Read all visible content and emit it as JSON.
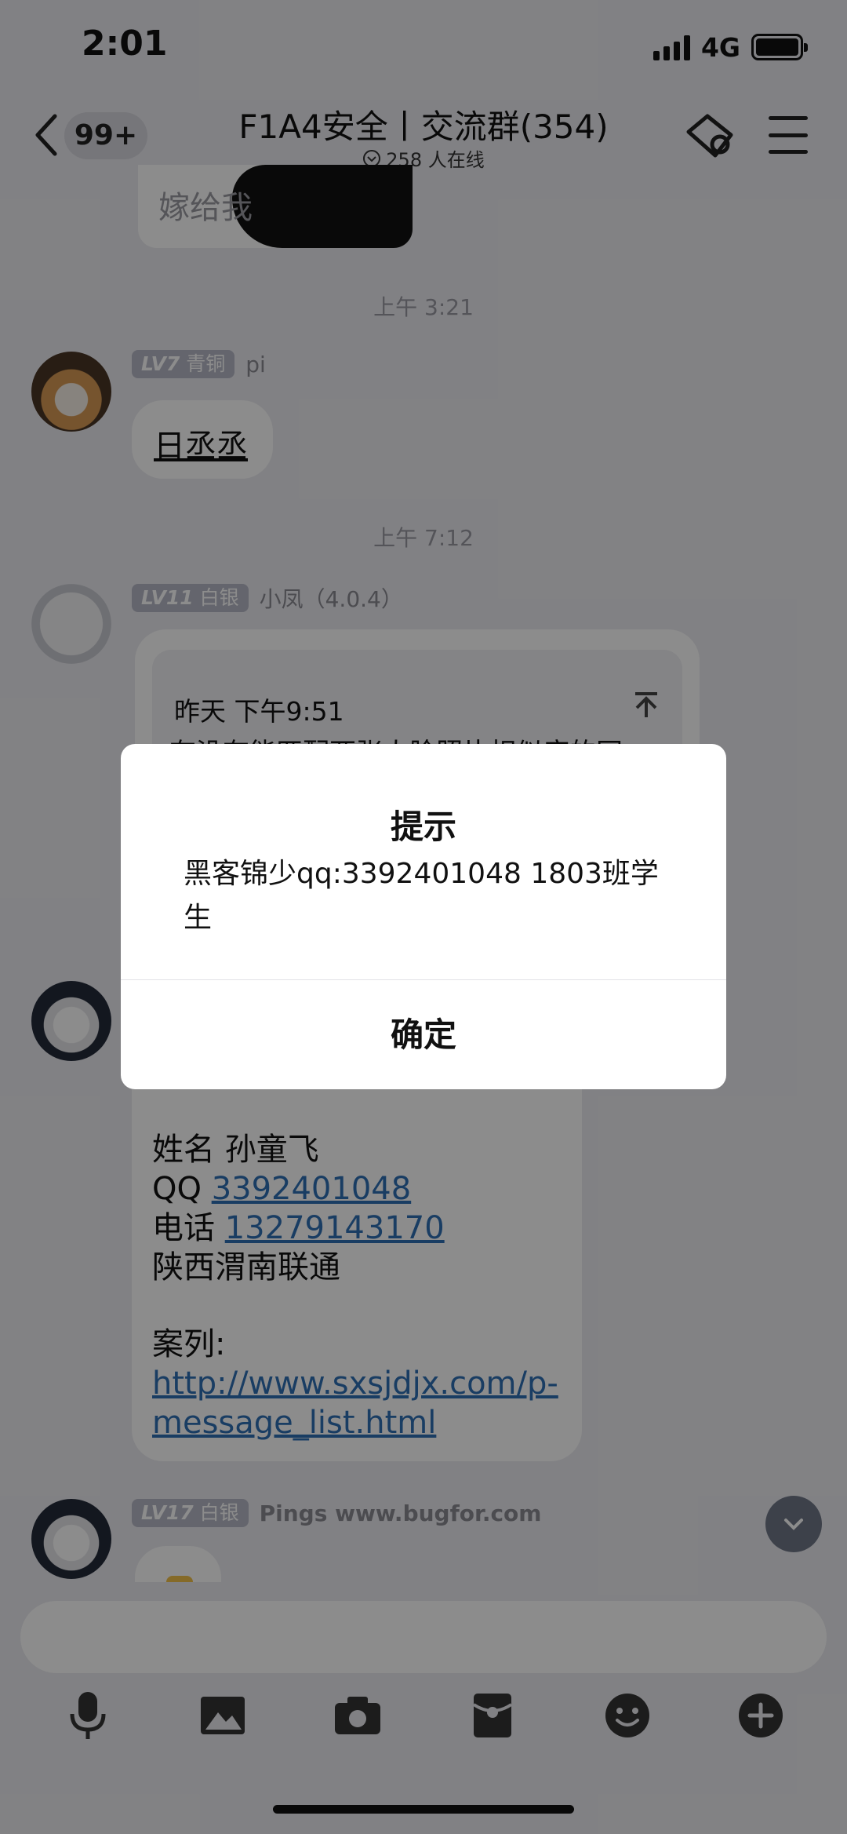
{
  "status_bar": {
    "time": "2:01",
    "network": "4G"
  },
  "header": {
    "unread_badge": "99+",
    "title": "F1A4安全丨交流群(354)",
    "online": "258 人在线"
  },
  "chat": {
    "top_bubble_text": "嫁给我",
    "time_1": "上午 3:21",
    "msg1": {
      "level": "LV7",
      "rank": "青铜",
      "nickname": "pi",
      "text": "日丞丞"
    },
    "time_2": "上午 7:12",
    "msg2": {
      "level": "LV11",
      "rank": "白银",
      "nickname": "小凤（4.0.4）",
      "quote_time": "昨天 下午9:51",
      "quote_text": "有没有能匹配两张人脸照片相似度的网"
    },
    "msg3": {
      "name_line": "姓名 孙童飞",
      "qq_label": "QQ ",
      "qq_value": "3392401048",
      "phone_label": "电话 ",
      "phone_value": "13279143170",
      "location": "陕西渭南联通",
      "case_label": "案列:",
      "case_link": "http://www.sxsjdjx.com/p-message_list.html"
    },
    "msg4": {
      "level": "LV17",
      "rank": "白银",
      "nickname": "Pings www.bugfor.com"
    }
  },
  "toolbar": {
    "icons": [
      "microphone-icon",
      "image-icon",
      "camera-icon",
      "red-packet-icon",
      "emoji-icon",
      "plus-icon"
    ]
  },
  "dialog": {
    "title": "提示",
    "message": "黑客锦少qq:3392401048 1803班学生",
    "confirm": "确定"
  },
  "colors": {
    "link": "#2f6fb5",
    "level_tag": "#b7b9c6",
    "background": "#ececf1"
  }
}
